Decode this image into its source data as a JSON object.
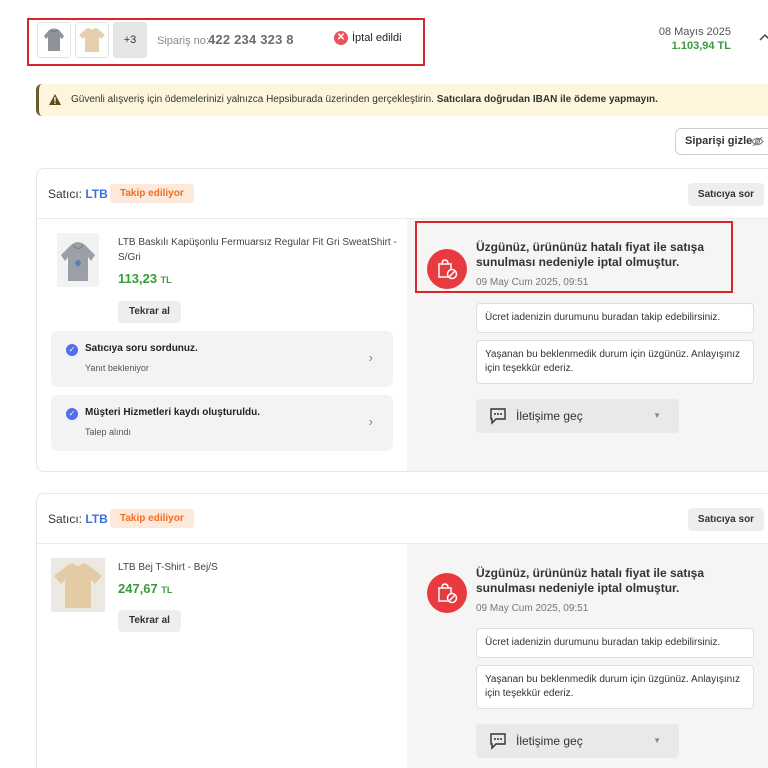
{
  "header": {
    "more_count": "+3",
    "order_no_label": "Sipariş no:",
    "order_no": "422 234 323 8",
    "status": "İptal edildi",
    "date": "08 Mayıs 2025",
    "total": "1.103,94 TL"
  },
  "warning": {
    "text": "Güvenli alışveriş için ödemelerinizi yalnızca Hepsiburada üzerinden gerçekleştirin.",
    "bold": "Satıcılara doğrudan IBAN ile ödeme yapmayın."
  },
  "hide_order_label": "Siparişi gizle",
  "cards": [
    {
      "seller_label": "Satıcı:",
      "seller_name": "LTB",
      "follow_label": "Takip ediliyor",
      "ask_label": "Satıcıya sor",
      "product_name": "LTB Baskılı Kapüşonlu Fermuarsız Regular Fit Gri SweatShirt - S/Gri",
      "price": "113,23",
      "currency": "TL",
      "rebuy_label": "Tekrar al",
      "steps": [
        {
          "title": "Satıcıya soru sordunuz.",
          "sub": "Yanıt bekleniyor"
        },
        {
          "title": "Müşteri Hizmetleri kaydı oluşturuldu.",
          "sub": "Talep alındı"
        }
      ],
      "cancel_message": "Üzgünüz, ürününüz hatalı fiyat ile satışa sunulması nedeniyle iptal olmuştur.",
      "cancel_date": "09 May Cum 2025, 09:51",
      "info1": "Ücret iadenizin durumunu buradan takip edebilirsiniz.",
      "info2": "Yaşanan bu beklenmedik durum için üzgünüz. Anlayışınız için teşekkür ederiz.",
      "contact_label": "İletişime geç"
    },
    {
      "seller_label": "Satıcı:",
      "seller_name": "LTB",
      "follow_label": "Takip ediliyor",
      "ask_label": "Satıcıya sor",
      "product_name": "LTB Bej T-Shirt - Bej/S",
      "price": "247,67",
      "currency": "TL",
      "rebuy_label": "Tekrar al",
      "cancel_message": "Üzgünüz, ürününüz hatalı fiyat ile satışa sunulması nedeniyle iptal olmuştur.",
      "cancel_date": "09 May Cum 2025, 09:51",
      "info1": "Ücret iadenizin durumunu buradan takip edebilirsiniz.",
      "info2": "Yaşanan bu beklenmedik durum için üzgünüz. Anlayışınız için teşekkür ederiz.",
      "contact_label": "İletişime geç"
    }
  ],
  "colors": {
    "price_green": "#3a9a3a",
    "seller_blue": "#3b6fe0",
    "follow_orange": "#f26e21",
    "cancel_red": "#e83a3f",
    "highlight_red": "#d9262c"
  }
}
